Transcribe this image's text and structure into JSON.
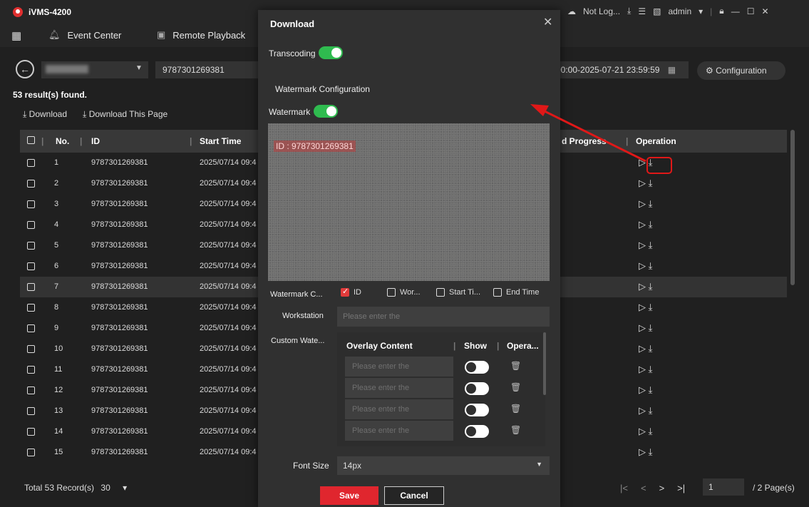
{
  "app": {
    "title": "iVMS-4200",
    "user": "admin",
    "status": "Not Log..."
  },
  "nav": {
    "tabs": [
      {
        "label": "Event Center",
        "icon": "bell-icon"
      },
      {
        "label": "Remote Playback",
        "icon": "playback-icon"
      }
    ]
  },
  "search": {
    "id_value": "9787301269381",
    "time_range": "00:00-2025-07-21 23:59:59",
    "config_label": "Configuration"
  },
  "results": {
    "found_text": "53 result(s) found.",
    "download_label": "Download",
    "download_page_label": "Download This Page"
  },
  "table": {
    "headers": {
      "no": "No.",
      "id": "ID",
      "start": "Start Time",
      "progress": "d Progress",
      "operation": "Operation"
    },
    "rows": [
      {
        "no": "1",
        "id": "9787301269381",
        "start": "2025/07/14 09:4"
      },
      {
        "no": "2",
        "id": "9787301269381",
        "start": "2025/07/14 09:4"
      },
      {
        "no": "3",
        "id": "9787301269381",
        "start": "2025/07/14 09:4"
      },
      {
        "no": "4",
        "id": "9787301269381",
        "start": "2025/07/14 09:4"
      },
      {
        "no": "5",
        "id": "9787301269381",
        "start": "2025/07/14 09:4"
      },
      {
        "no": "6",
        "id": "9787301269381",
        "start": "2025/07/14 09:4"
      },
      {
        "no": "7",
        "id": "9787301269381",
        "start": "2025/07/14 09:4"
      },
      {
        "no": "8",
        "id": "9787301269381",
        "start": "2025/07/14 09:4"
      },
      {
        "no": "9",
        "id": "9787301269381",
        "start": "2025/07/14 09:4"
      },
      {
        "no": "10",
        "id": "9787301269381",
        "start": "2025/07/14 09:4"
      },
      {
        "no": "11",
        "id": "9787301269381",
        "start": "2025/07/14 09:4"
      },
      {
        "no": "12",
        "id": "9787301269381",
        "start": "2025/07/14 09:4"
      },
      {
        "no": "13",
        "id": "9787301269381",
        "start": "2025/07/14 09:4"
      },
      {
        "no": "14",
        "id": "9787301269381",
        "start": "2025/07/14 09:4"
      },
      {
        "no": "15",
        "id": "9787301269381",
        "start": "2025/07/14 09:4"
      }
    ]
  },
  "footer": {
    "total": "Total 53 Record(s)",
    "per_page": "30",
    "page": "1",
    "page_total": "/ 2 Page(s)"
  },
  "modal": {
    "title": "Download",
    "transcoding_label": "Transcoding",
    "watermark_config_heading": "Watermark Configuration",
    "watermark_label": "Watermark",
    "watermark_text": "ID : 9787301269381",
    "watermark_content_label": "Watermark C...",
    "options": [
      {
        "label": "ID",
        "checked": true
      },
      {
        "label": "Wor...",
        "checked": false
      },
      {
        "label": "Start Ti...",
        "checked": false
      },
      {
        "label": "End Time",
        "checked": false
      }
    ],
    "workstation_label": "Workstation",
    "workstation_placeholder": "Please enter the",
    "custom_label": "Custom Wate...",
    "custom_headers": {
      "content": "Overlay Content",
      "show": "Show",
      "op": "Opera..."
    },
    "custom_rows": [
      {
        "placeholder": "Please enter the"
      },
      {
        "placeholder": "Please enter the"
      },
      {
        "placeholder": "Please enter the"
      },
      {
        "placeholder": "Please enter the"
      }
    ],
    "font_size_label": "Font Size",
    "font_size_value": "14px",
    "save_label": "Save",
    "cancel_label": "Cancel"
  },
  "colors": {
    "accent_red": "#e0262e",
    "toggle_green": "#2fbb4f"
  }
}
